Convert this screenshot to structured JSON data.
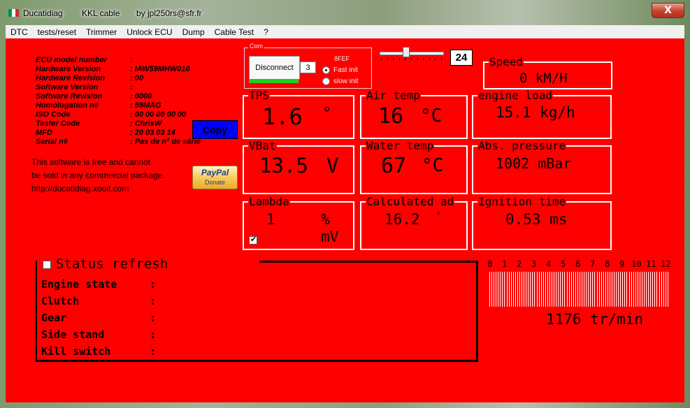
{
  "window": {
    "flag_colors": [
      "#009246",
      "#ffffff",
      "#ce2b37"
    ],
    "title": "Ducatidiag",
    "cable": "KKL cable",
    "author": "by jpl250rs@sfr.fr",
    "close_label": "X"
  },
  "menu": [
    "DTC",
    "tests/reset",
    "Trimmer",
    "Unlock ECU",
    "Dump",
    "Cable Test",
    "?"
  ],
  "ecu_info": {
    "labels": [
      "ECU model number",
      "Hardware Version",
      "Hardware Revision",
      "Software Version",
      "Software Revision",
      "Homologation n#",
      "ISO Code",
      "Tester Code",
      "MFD",
      "Serial n#"
    ],
    "values": [
      ": ",
      ": IAW59MHW010",
      ": 00",
      ": ",
      ": 0000",
      ": 59MAG",
      ": 00 00 00 00 00",
      ": ChrisW",
      ": 20 03 03 14",
      ": Pas de n° de série"
    ]
  },
  "copy_button": "Copy",
  "notice": {
    "line1": "This software is free and cannot",
    "line2": "be sold in any commercial package.",
    "line3": "http://ducatidiag.xooit.com"
  },
  "paypal": {
    "brand": "PayPal",
    "donate": "Donate"
  },
  "com": {
    "legend": "Com",
    "disconnect_label": "Disconnect",
    "port": "3",
    "protocol_label": "8FEF",
    "fast_init": "Fast init",
    "slow_init": "slow init",
    "selected": "fast"
  },
  "slider": {
    "value": "24",
    "level": 0.4
  },
  "gauges": {
    "speed": {
      "label": "Speed",
      "value": "0 kM/H"
    },
    "tps": {
      "label": "TPS",
      "value": "1.6",
      "unit": "°"
    },
    "air_temp": {
      "label": "Air temp",
      "value": "16",
      "unit": "°C"
    },
    "engine_load": {
      "label": "engine load",
      "value": "15.1 kg/h"
    },
    "vbat": {
      "label": "VBat",
      "value": "13.5",
      "unit": "V"
    },
    "water_temp": {
      "label": "Water temp",
      "value": "67",
      "unit": "°C"
    },
    "abs_pressure": {
      "label": "Abs. pressure",
      "value": "1002 mBar"
    },
    "lambda": {
      "label": "Lambda",
      "value": "1",
      "unit_pct": "%",
      "unit_mv": "mV"
    },
    "calc_advance": {
      "label": "Calculated ad",
      "value": "16.2",
      "unit": "°"
    },
    "ignition": {
      "label": "Ignition time",
      "value": "0.53 ms"
    }
  },
  "status": {
    "title": "Status refresh",
    "rows": [
      {
        "label": "Engine state",
        "sep": ":"
      },
      {
        "label": "Clutch",
        "sep": ":"
      },
      {
        "label": "Gear",
        "sep": ":"
      },
      {
        "label": "Side stand",
        "sep": ":"
      },
      {
        "label": "Kill switch",
        "sep": ":"
      }
    ]
  },
  "rpm": {
    "scale": [
      "0",
      "1",
      "2",
      "3",
      "4",
      "5",
      "6",
      "7",
      "8",
      "9",
      "10",
      "11",
      "12"
    ],
    "value": "1176 tr/min"
  }
}
